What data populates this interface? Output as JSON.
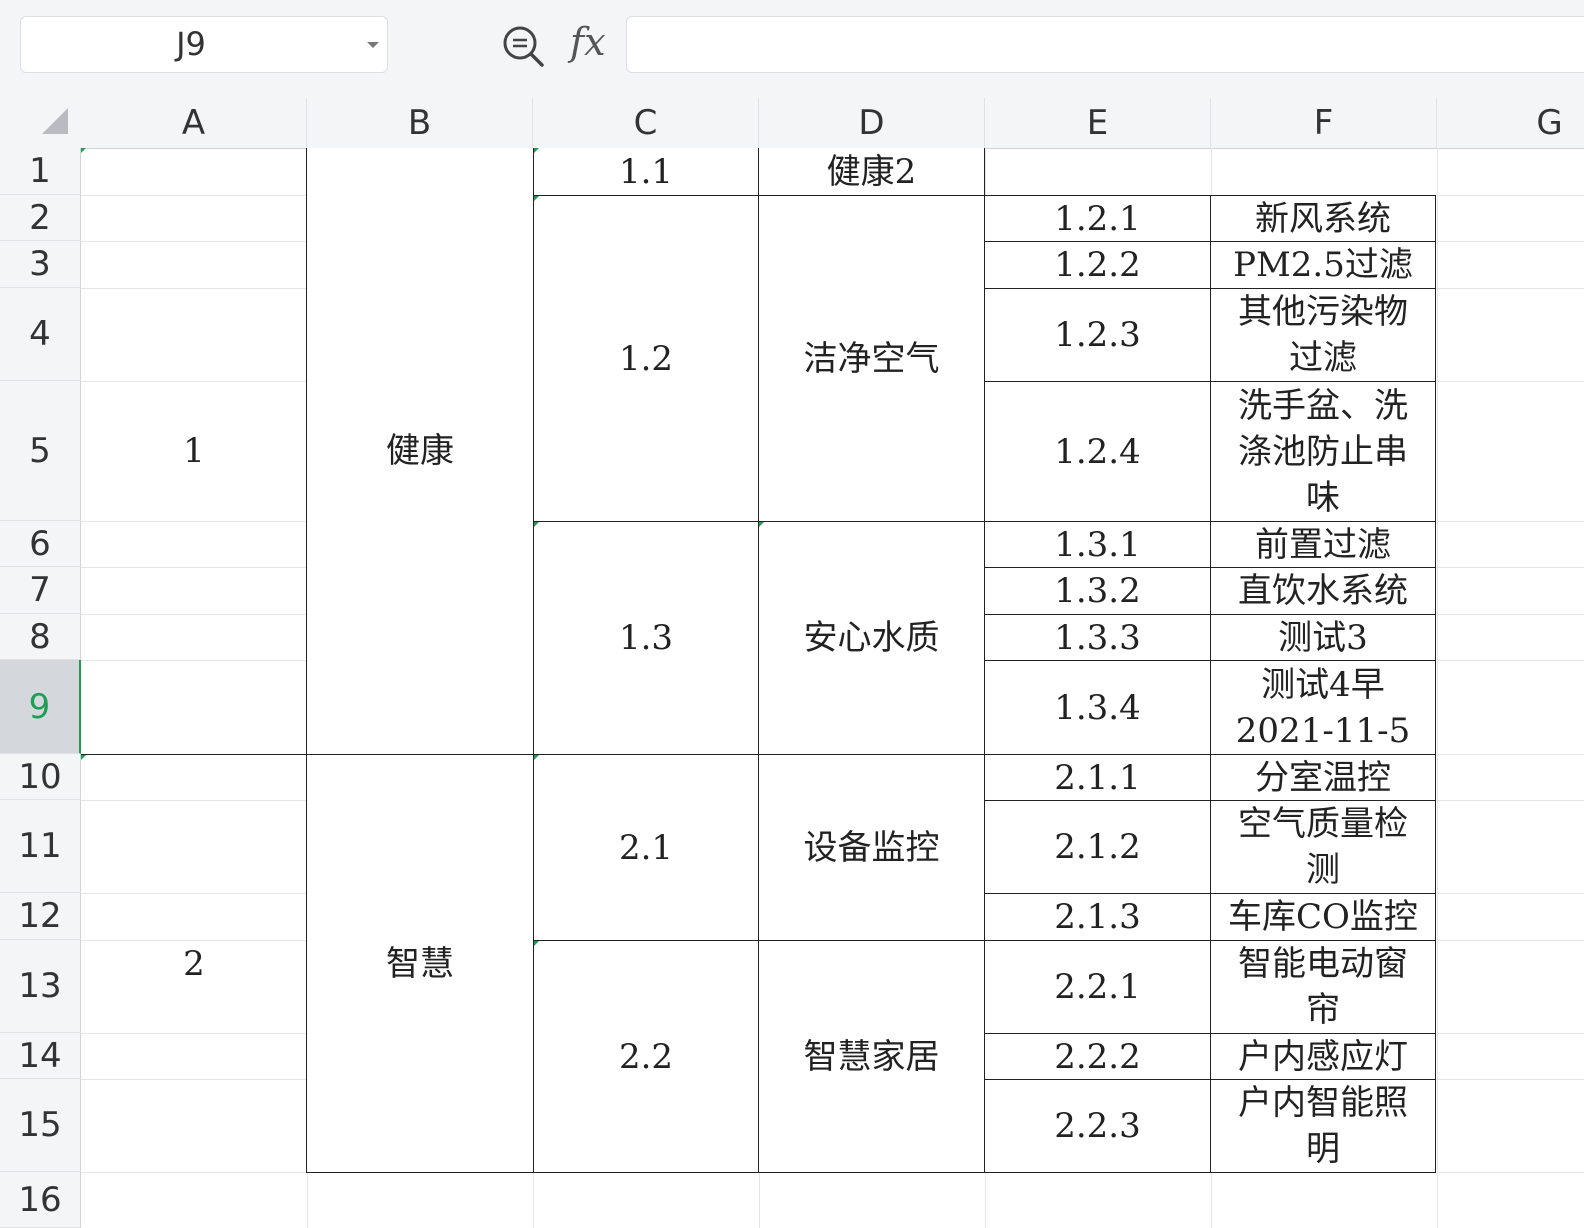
{
  "name_box": {
    "value": "J9"
  },
  "formula": {
    "fx_label": "fx",
    "value": ""
  },
  "columns": [
    "A",
    "B",
    "C",
    "D",
    "E",
    "F",
    "G"
  ],
  "rows": [
    "1",
    "2",
    "3",
    "4",
    "5",
    "6",
    "7",
    "8",
    "9",
    "10",
    "11",
    "12",
    "13",
    "14",
    "15",
    "16"
  ],
  "active_row": "9",
  "cells": {
    "A1": "1",
    "B1": "健康",
    "C1": "1.1",
    "D1": "健康2",
    "C2": "1.2",
    "D2": "洁净空气",
    "E2": "1.2.1",
    "F2": "新风系统",
    "E3": "1.2.2",
    "F3": "PM2.5过滤",
    "E4": "1.2.3",
    "F4": "其他污染物\n过滤",
    "E5": "1.2.4",
    "F5": "洗手盆、洗\n涤池防止串\n味",
    "C6": "1.3",
    "D6": "安心水质",
    "E6": "1.3.1",
    "F6": "前置过滤",
    "E7": "1.3.2",
    "F7": "直饮水系统",
    "E8": "1.3.3",
    "F8": "测试3",
    "E9": "1.3.4",
    "F9": "测试4早\n2021-11-5",
    "A10": "2",
    "B10": "智慧",
    "C10": "2.1",
    "D10": "设备监控",
    "E10": "2.1.1",
    "F10": "分室温控",
    "E11": "2.1.2",
    "F11": "空气质量检\n测",
    "E12": "2.1.3",
    "F12": "车库CO监控",
    "C13": "2.2",
    "D13": "智慧家居",
    "E13": "2.2.1",
    "F13": "智能电动窗\n帘",
    "E14": "2.2.2",
    "F14": "户内感应灯",
    "E15": "2.2.3",
    "F15": "户内智能照\n明"
  }
}
